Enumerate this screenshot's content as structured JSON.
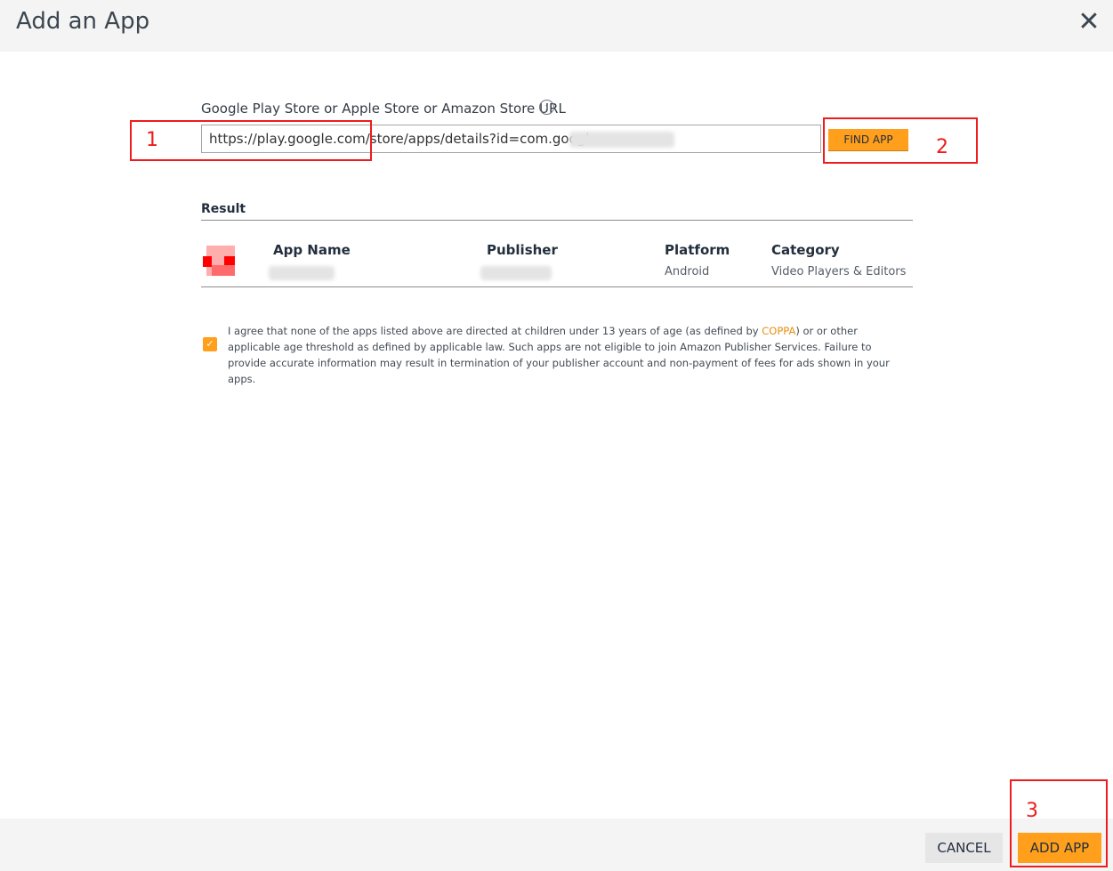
{
  "dialog": {
    "title": "Add an App",
    "close_icon": "close-icon"
  },
  "url_field": {
    "label": "Google Play Store or Apple Store or Amazon Store URL",
    "info_icon": "info-icon",
    "info_glyph": "i",
    "value": "https://play.google.com/store/apps/details?id=com.google."
  },
  "find_button": {
    "label": "FIND APP"
  },
  "result": {
    "heading": "Result",
    "columns": {
      "app_name": "App Name",
      "publisher": "Publisher",
      "platform": "Platform",
      "category": "Category"
    },
    "row": {
      "platform": "Android",
      "category": "Video Players & Editors"
    }
  },
  "agreement": {
    "checked": true,
    "check_glyph": "✓",
    "text_before": "I agree that none of the apps listed above are directed at children under 13 years of age (as defined by ",
    "link_text": "COPPA",
    "text_after": ") or or other applicable age threshold as defined by applicable law. Such apps are not eligible to join Amazon Publisher Services. Failure to provide accurate information may result in termination of your publisher account and non-payment of fees for ads shown in your apps."
  },
  "footer": {
    "cancel_label": "CANCEL",
    "add_label": "ADD APP"
  },
  "annotations": [
    "1",
    "2",
    "3"
  ],
  "colors": {
    "accent": "#ff9f1c",
    "annotation": "#ee1c1c",
    "link": "#e88f10"
  }
}
